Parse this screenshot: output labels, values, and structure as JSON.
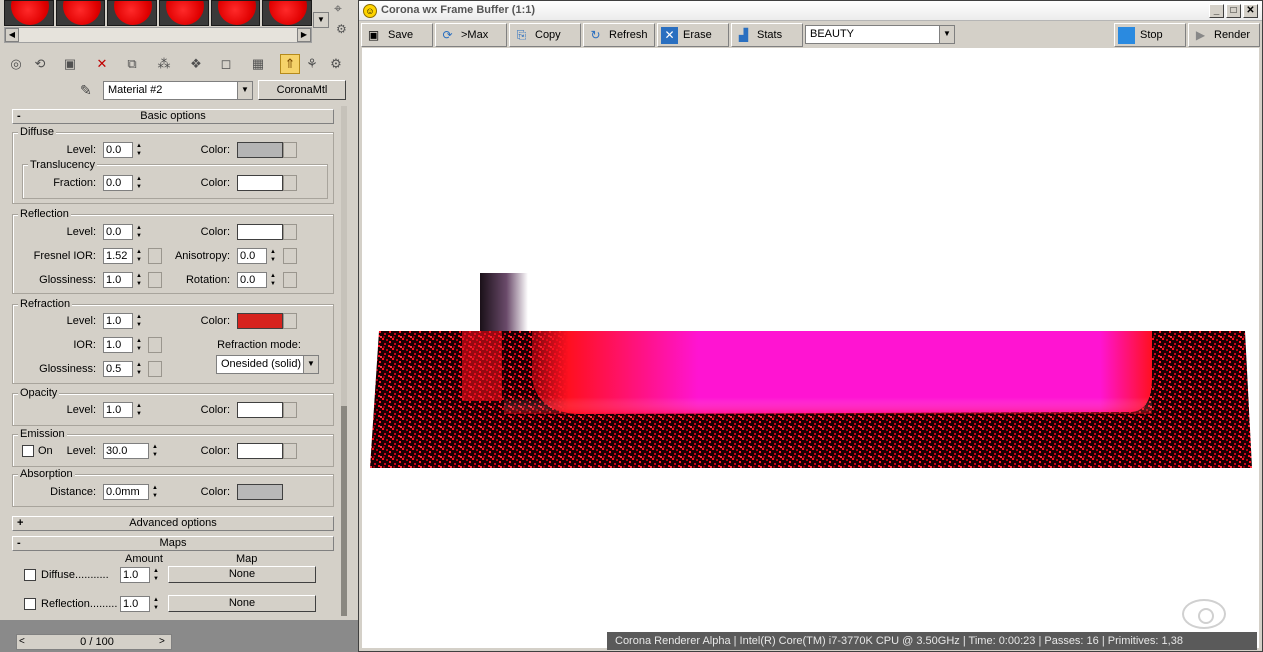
{
  "editor": {
    "material_name": "Material #2",
    "material_type": "CoronaMtl",
    "basic_options": "Basic options",
    "advanced_options": "Advanced options",
    "maps": "Maps",
    "diffuse": {
      "group": "Diffuse",
      "level_label": "Level:",
      "level": "0.0",
      "color_label": "Color:",
      "color": "#b4b4b4",
      "translucency_group": "Translucency",
      "fraction_label": "Fraction:",
      "fraction": "0.0",
      "trans_color_label": "Color:",
      "trans_color": "#ffffff"
    },
    "reflection": {
      "group": "Reflection",
      "level_label": "Level:",
      "level": "0.0",
      "color_label": "Color:",
      "color": "#ffffff",
      "fresnel_label": "Fresnel IOR:",
      "fresnel": "1.52",
      "anisotropy_label": "Anisotropy:",
      "anisotropy": "0.0",
      "glossiness_label": "Glossiness:",
      "glossiness": "1.0",
      "rotation_label": "Rotation:",
      "rotation": "0.0"
    },
    "refraction": {
      "group": "Refraction",
      "level_label": "Level:",
      "level": "1.0",
      "color_label": "Color:",
      "color": "#d6231e",
      "ior_label": "IOR:",
      "ior": "1.0",
      "mode_label": "Refraction mode:",
      "mode": "Onesided (solid)",
      "glossiness_label": "Glossiness:",
      "glossiness": "0.5"
    },
    "opacity": {
      "group": "Opacity",
      "level_label": "Level:",
      "level": "1.0",
      "color_label": "Color:",
      "color": "#ffffff"
    },
    "emission": {
      "group": "Emission",
      "on_label": "On",
      "level_label": "Level:",
      "level": "30.0",
      "color_label": "Color:",
      "color": "#ffffff"
    },
    "absorption": {
      "group": "Absorption",
      "distance_label": "Distance:",
      "distance": "0.0mm",
      "color_label": "Color:",
      "color": "#b8b8b8"
    },
    "maps_table": {
      "amount_header": "Amount",
      "map_header": "Map",
      "rows": [
        {
          "label": "Diffuse...........",
          "amount": "1.0",
          "map": "None"
        },
        {
          "label": "Reflection.........",
          "amount": "1.0",
          "map": "None"
        }
      ]
    },
    "pager": "0 / 100"
  },
  "framebuffer": {
    "title": "Corona wx Frame Buffer (1:1)",
    "buttons": {
      "save": "Save",
      "max": ">Max",
      "copy": "Copy",
      "refresh": "Refresh",
      "erase": "Erase",
      "stats": "Stats",
      "stop": "Stop",
      "render": "Render"
    },
    "channel": "BEAUTY",
    "status": "Corona Renderer Alpha | Intel(R) Core(TM) i7-3770K CPU @ 3.50GHz | Time: 0:00:23 | Passes: 16 | Primitives: 1,38"
  },
  "colors": {
    "panel": "#d4d0c8",
    "render_magenta": "#ff14d2",
    "render_red": "#ff1020"
  }
}
